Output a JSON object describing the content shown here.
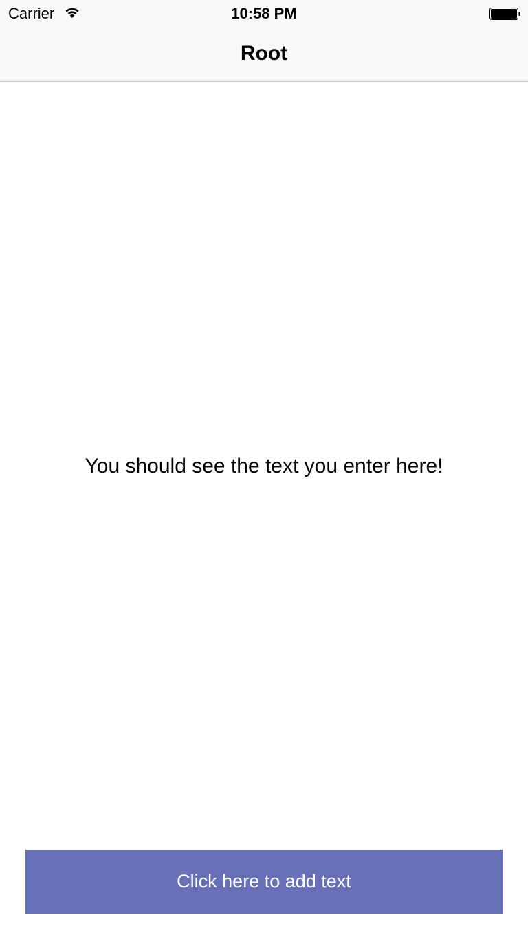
{
  "status_bar": {
    "carrier": "Carrier",
    "time": "10:58 PM",
    "wifi_icon": "wifi-icon",
    "battery_icon": "battery-icon"
  },
  "nav_bar": {
    "title": "Root"
  },
  "main": {
    "message": "You should see the text you enter here!",
    "add_text_button_label": "Click here to add text"
  },
  "colors": {
    "bar_background": "#f8f8f8",
    "button_background": "#6870b8",
    "button_text": "#ffffff",
    "text": "#000000"
  }
}
